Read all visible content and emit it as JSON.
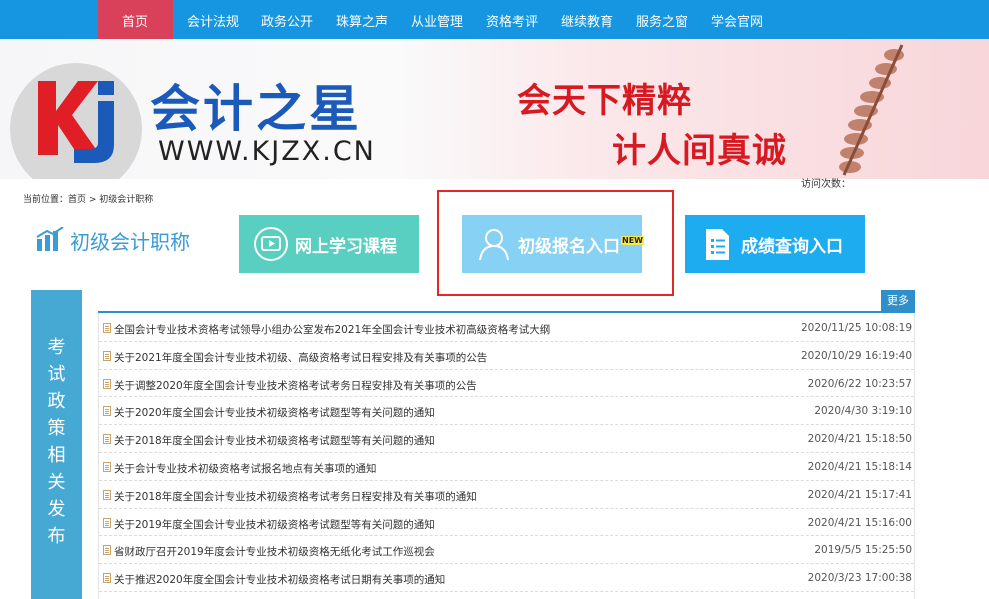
{
  "nav": {
    "items": [
      "首页",
      "会计法规",
      "政务公开",
      "珠算之声",
      "从业管理",
      "资格考评",
      "继续教育",
      "服务之窗",
      "学会官网"
    ],
    "active_color": "#d9415a",
    "bar_color": "#1696e0"
  },
  "banner": {
    "logo_text": "kj",
    "brand": "会计之星",
    "domain": "WWW.KJZX.CN",
    "slogan_line1": "会天下精粹",
    "slogan_line2": "计人间真诚"
  },
  "breadcrumb": "当前位置：首页 > 初级会计职称",
  "visits_label": "访问次数：",
  "section": {
    "title": "初级会计职称",
    "icon": "bar-chart-icon"
  },
  "entries": [
    {
      "label": "网上学习课程",
      "icon": "video-play-icon",
      "color": "#58cfc0"
    },
    {
      "label": "初级报名入口",
      "icon": "user-icon",
      "badge": "NEW",
      "color": "#86d1f4"
    },
    {
      "label": "成绩查询入口",
      "icon": "document-icon",
      "color": "#1eacf0"
    }
  ],
  "side_block": {
    "text": "考试政策相关发布",
    "color": "#45a9d4"
  },
  "list": {
    "more_label": "更多",
    "items": [
      {
        "title": "全国会计专业技术资格考试领导小组办公室发布2021年全国会计专业技术初高级资格考试大纲",
        "date": "2020/11/25 10:08:19"
      },
      {
        "title": "关于2021年度全国会计专业技术初级、高级资格考试日程安排及有关事项的公告",
        "date": "2020/10/29 16:19:40"
      },
      {
        "title": "关于调整2020年度全国会计专业技术资格考试考务日程安排及有关事项的公告",
        "date": "2020/6/22 10:23:57"
      },
      {
        "title": "关于2020年度全国会计专业技术初级资格考试题型等有关问题的通知",
        "date": "2020/4/30 3:19:10"
      },
      {
        "title": "关于2018年度全国会计专业技术初级资格考试题型等有关问题的通知",
        "date": "2020/4/21 15:18:50"
      },
      {
        "title": "关于会计专业技术初级资格考试报名地点有关事项的通知",
        "date": "2020/4/21 15:18:14"
      },
      {
        "title": "关于2018年度全国会计专业技术初级资格考试考务日程安排及有关事项的通知",
        "date": "2020/4/21 15:17:41"
      },
      {
        "title": "关于2019年度全国会计专业技术初级资格考试题型等有关问题的通知",
        "date": "2020/4/21 15:16:00"
      },
      {
        "title": "省财政厅召开2019年度会计专业技术初级资格无纸化考试工作巡视会",
        "date": "2019/5/5 15:25:50"
      },
      {
        "title": "关于推迟2020年度全国会计专业技术初级资格考试日期有关事项的通知",
        "date": "2020/3/23 17:00:38"
      }
    ]
  }
}
